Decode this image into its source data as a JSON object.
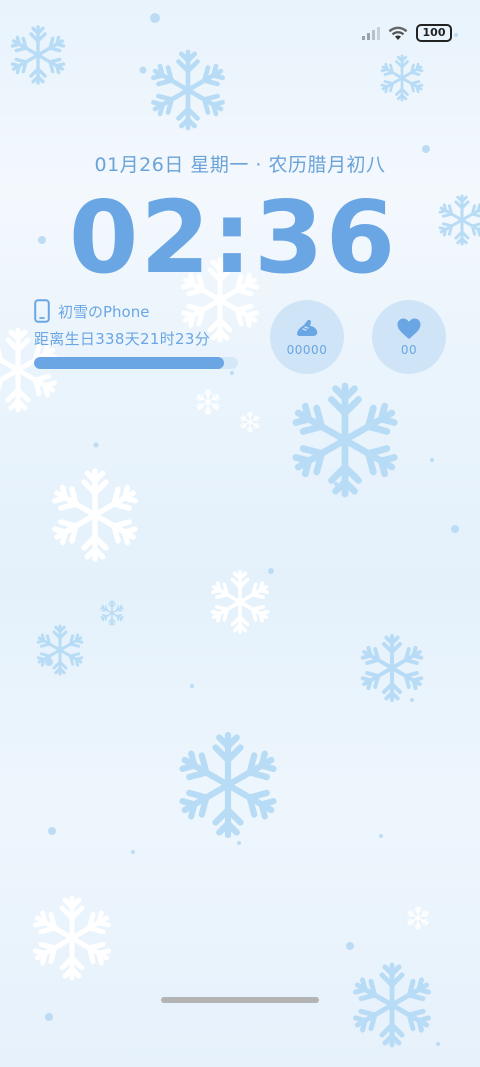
{
  "status_bar": {
    "battery_level": "100"
  },
  "lock_screen": {
    "date": "01月26日 星期一 · 农历腊月初八",
    "time": "02:36"
  },
  "device_widget": {
    "name": "初雪のPhone",
    "countdown": "距离生日338天21时23分",
    "progress_fraction": 0.93
  },
  "steps_widget": {
    "icon": "shoe-icon",
    "value": "00000"
  },
  "heart_widget": {
    "icon": "heart-icon",
    "value": "00"
  },
  "colors": {
    "accent": "#6aa6e3",
    "widget_bg": "#cfe5f7",
    "flake": "#b8dcf5"
  }
}
